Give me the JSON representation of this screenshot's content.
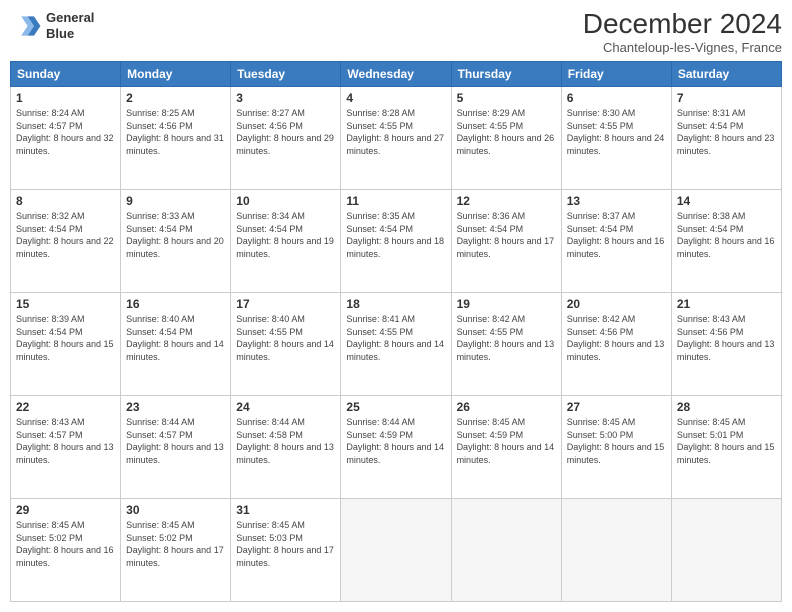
{
  "header": {
    "logo_line1": "General",
    "logo_line2": "Blue",
    "month_title": "December 2024",
    "location": "Chanteloup-les-Vignes, France"
  },
  "days_of_week": [
    "Sunday",
    "Monday",
    "Tuesday",
    "Wednesday",
    "Thursday",
    "Friday",
    "Saturday"
  ],
  "weeks": [
    [
      {
        "day": "1",
        "sunrise": "8:24 AM",
        "sunset": "4:57 PM",
        "daylight": "8 hours and 32 minutes."
      },
      {
        "day": "2",
        "sunrise": "8:25 AM",
        "sunset": "4:56 PM",
        "daylight": "8 hours and 31 minutes."
      },
      {
        "day": "3",
        "sunrise": "8:27 AM",
        "sunset": "4:56 PM",
        "daylight": "8 hours and 29 minutes."
      },
      {
        "day": "4",
        "sunrise": "8:28 AM",
        "sunset": "4:55 PM",
        "daylight": "8 hours and 27 minutes."
      },
      {
        "day": "5",
        "sunrise": "8:29 AM",
        "sunset": "4:55 PM",
        "daylight": "8 hours and 26 minutes."
      },
      {
        "day": "6",
        "sunrise": "8:30 AM",
        "sunset": "4:55 PM",
        "daylight": "8 hours and 24 minutes."
      },
      {
        "day": "7",
        "sunrise": "8:31 AM",
        "sunset": "4:54 PM",
        "daylight": "8 hours and 23 minutes."
      }
    ],
    [
      {
        "day": "8",
        "sunrise": "8:32 AM",
        "sunset": "4:54 PM",
        "daylight": "8 hours and 22 minutes."
      },
      {
        "day": "9",
        "sunrise": "8:33 AM",
        "sunset": "4:54 PM",
        "daylight": "8 hours and 20 minutes."
      },
      {
        "day": "10",
        "sunrise": "8:34 AM",
        "sunset": "4:54 PM",
        "daylight": "8 hours and 19 minutes."
      },
      {
        "day": "11",
        "sunrise": "8:35 AM",
        "sunset": "4:54 PM",
        "daylight": "8 hours and 18 minutes."
      },
      {
        "day": "12",
        "sunrise": "8:36 AM",
        "sunset": "4:54 PM",
        "daylight": "8 hours and 17 minutes."
      },
      {
        "day": "13",
        "sunrise": "8:37 AM",
        "sunset": "4:54 PM",
        "daylight": "8 hours and 16 minutes."
      },
      {
        "day": "14",
        "sunrise": "8:38 AM",
        "sunset": "4:54 PM",
        "daylight": "8 hours and 16 minutes."
      }
    ],
    [
      {
        "day": "15",
        "sunrise": "8:39 AM",
        "sunset": "4:54 PM",
        "daylight": "8 hours and 15 minutes."
      },
      {
        "day": "16",
        "sunrise": "8:40 AM",
        "sunset": "4:54 PM",
        "daylight": "8 hours and 14 minutes."
      },
      {
        "day": "17",
        "sunrise": "8:40 AM",
        "sunset": "4:55 PM",
        "daylight": "8 hours and 14 minutes."
      },
      {
        "day": "18",
        "sunrise": "8:41 AM",
        "sunset": "4:55 PM",
        "daylight": "8 hours and 14 minutes."
      },
      {
        "day": "19",
        "sunrise": "8:42 AM",
        "sunset": "4:55 PM",
        "daylight": "8 hours and 13 minutes."
      },
      {
        "day": "20",
        "sunrise": "8:42 AM",
        "sunset": "4:56 PM",
        "daylight": "8 hours and 13 minutes."
      },
      {
        "day": "21",
        "sunrise": "8:43 AM",
        "sunset": "4:56 PM",
        "daylight": "8 hours and 13 minutes."
      }
    ],
    [
      {
        "day": "22",
        "sunrise": "8:43 AM",
        "sunset": "4:57 PM",
        "daylight": "8 hours and 13 minutes."
      },
      {
        "day": "23",
        "sunrise": "8:44 AM",
        "sunset": "4:57 PM",
        "daylight": "8 hours and 13 minutes."
      },
      {
        "day": "24",
        "sunrise": "8:44 AM",
        "sunset": "4:58 PM",
        "daylight": "8 hours and 13 minutes."
      },
      {
        "day": "25",
        "sunrise": "8:44 AM",
        "sunset": "4:59 PM",
        "daylight": "8 hours and 14 minutes."
      },
      {
        "day": "26",
        "sunrise": "8:45 AM",
        "sunset": "4:59 PM",
        "daylight": "8 hours and 14 minutes."
      },
      {
        "day": "27",
        "sunrise": "8:45 AM",
        "sunset": "5:00 PM",
        "daylight": "8 hours and 15 minutes."
      },
      {
        "day": "28",
        "sunrise": "8:45 AM",
        "sunset": "5:01 PM",
        "daylight": "8 hours and 15 minutes."
      }
    ],
    [
      {
        "day": "29",
        "sunrise": "8:45 AM",
        "sunset": "5:02 PM",
        "daylight": "8 hours and 16 minutes."
      },
      {
        "day": "30",
        "sunrise": "8:45 AM",
        "sunset": "5:02 PM",
        "daylight": "8 hours and 17 minutes."
      },
      {
        "day": "31",
        "sunrise": "8:45 AM",
        "sunset": "5:03 PM",
        "daylight": "8 hours and 17 minutes."
      },
      null,
      null,
      null,
      null
    ]
  ]
}
